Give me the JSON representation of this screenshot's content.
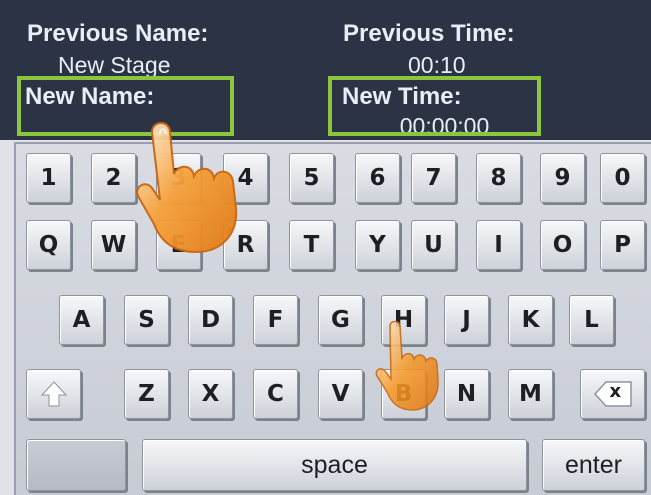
{
  "header": {
    "previous_name_label": "Previous Name:",
    "previous_name_value": "New Stage",
    "previous_time_label": "Previous Time:",
    "previous_time_value": "00:10",
    "new_name_label": "New Name:",
    "new_name_value": "",
    "new_time_label": "New Time:",
    "new_time_value": "00:00:00"
  },
  "keyboard": {
    "row1": [
      "1",
      "2",
      "3",
      "4",
      "5",
      "6",
      "7",
      "8",
      "9",
      "0"
    ],
    "row2": [
      "Q",
      "W",
      "E",
      "R",
      "T",
      "Y",
      "U",
      "I",
      "O",
      "P"
    ],
    "row3": [
      "A",
      "S",
      "D",
      "F",
      "G",
      "H",
      "J",
      "K",
      "L"
    ],
    "row4": [
      "Z",
      "X",
      "C",
      "V",
      "B",
      "N",
      "M"
    ],
    "shift_icon": "shift-arrow-icon",
    "backspace_icon": "backspace-icon",
    "backspace_glyph": "x",
    "space_label": "space",
    "enter_label": "enter"
  },
  "overlays": {
    "pointer_hand_large": "pointing-hand-icon",
    "pointer_hand_small": "pointing-hand-icon"
  },
  "colors": {
    "header_bg": "#2b3344",
    "highlight_border": "#8cc63f",
    "hand_orange": "#f59a2b"
  }
}
